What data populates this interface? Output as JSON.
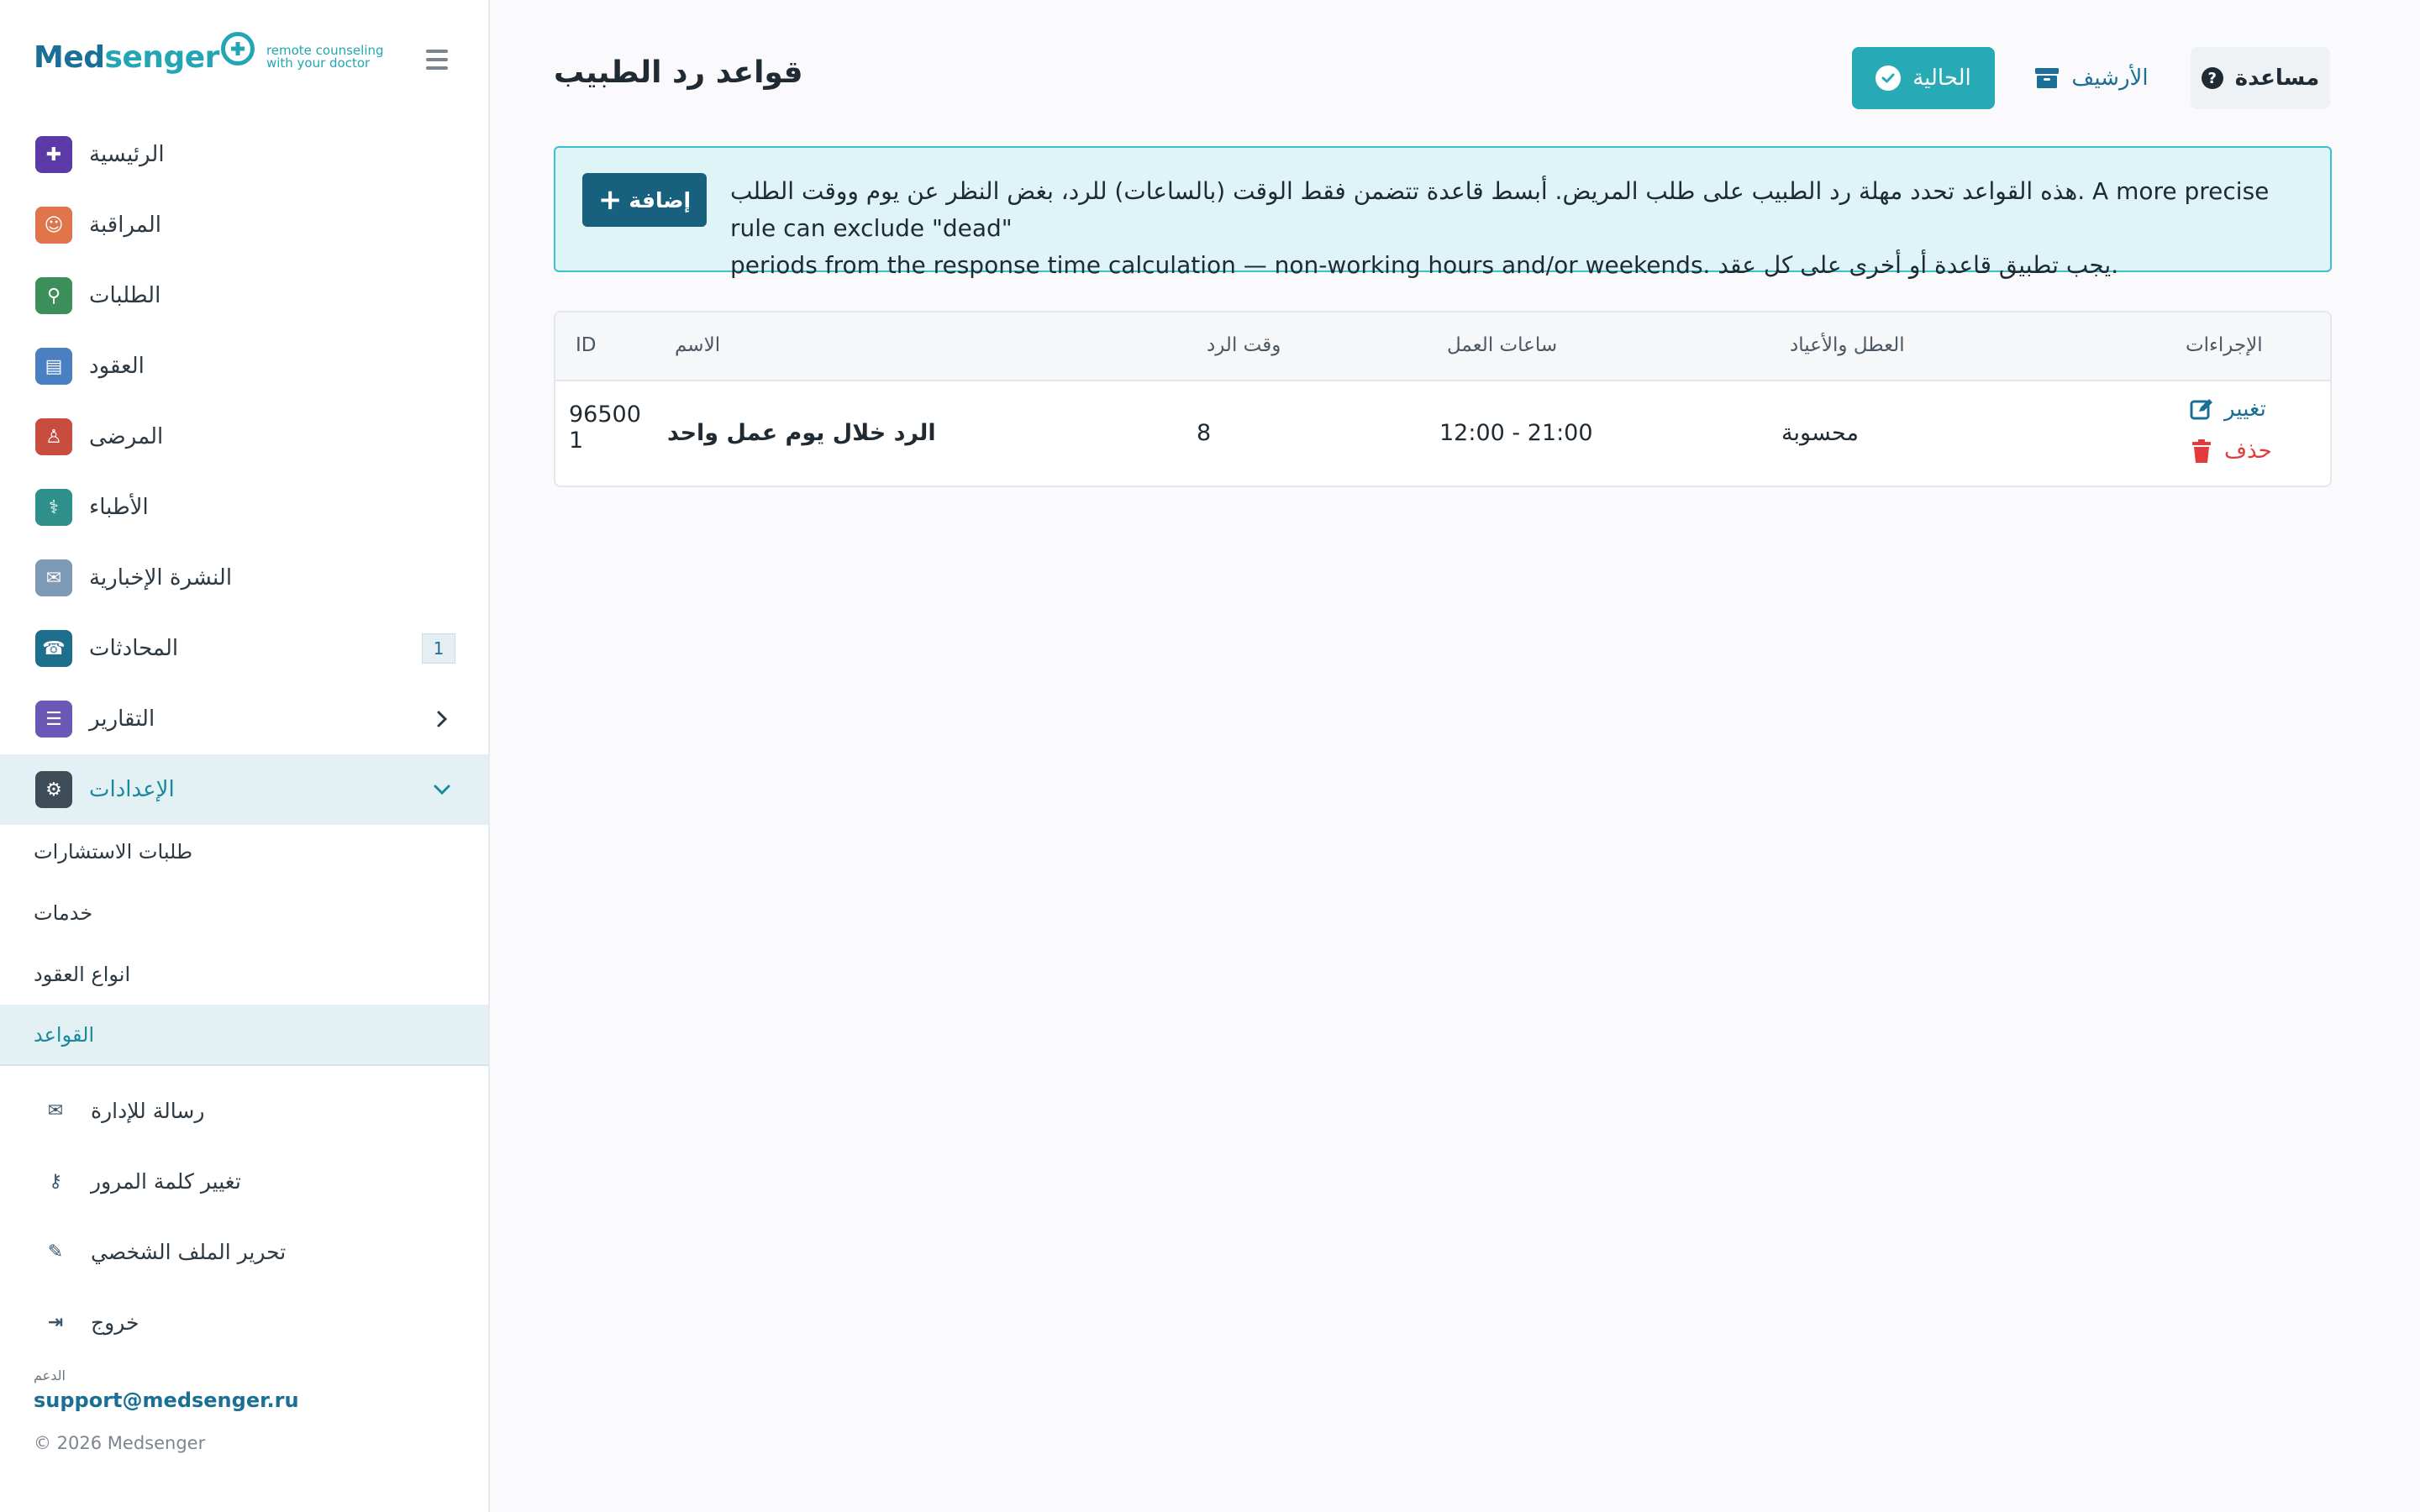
{
  "brand": {
    "name_a": "Med",
    "name_b": "senger",
    "tagline_1": "remote counseling",
    "tagline_2": "with your doctor"
  },
  "sidebar": {
    "items": [
      {
        "label": "الرئيسية",
        "icon": "hospital-icon",
        "color": "#5b3aa8"
      },
      {
        "label": "المراقبة",
        "icon": "doctor-icon",
        "color": "#e0744a"
      },
      {
        "label": "الطلبات",
        "icon": "user-search-icon",
        "color": "#3c8f5a"
      },
      {
        "label": "العقود",
        "icon": "contract-icon",
        "color": "#4a7fc1"
      },
      {
        "label": "المرضى",
        "icon": "patient-icon",
        "color": "#c94d3f"
      },
      {
        "label": "الأطباء",
        "icon": "physician-icon",
        "color": "#2f8f8a"
      },
      {
        "label": "النشرة الإخبارية",
        "icon": "mail-send-icon",
        "color": "#7e9bb5"
      },
      {
        "label": "المحادثات",
        "icon": "phone-icon",
        "color": "#1e6f8c",
        "badge": "1"
      },
      {
        "label": "التقارير",
        "icon": "report-icon",
        "color": "#6b57b6"
      },
      {
        "label": "الإعدادات",
        "icon": "gear-icon",
        "color": "#3e4c57"
      }
    ],
    "sub_items": [
      "طلبات الاستشارات",
      "خدمات",
      "انواع العقود",
      "القواعد"
    ],
    "bottom_items": [
      {
        "label": "رسالة للإدارة",
        "icon": "envelope-icon"
      },
      {
        "label": "تغيير كلمة المرور",
        "icon": "key-icon"
      },
      {
        "label": "تحرير الملف الشخصي",
        "icon": "user-edit-icon"
      },
      {
        "label": "خروج",
        "icon": "door-exit-icon"
      }
    ],
    "support_label": "الدعم",
    "support_email": "support@medsenger.ru",
    "copyright": "© 2026 Medsenger"
  },
  "header": {
    "title": "قواعد رد الطبيب",
    "btn_current": "الحالية",
    "btn_archive": "الأرشيف",
    "btn_help": "مساعدة"
  },
  "info": {
    "add_label": "إضافة",
    "line_1": "هذه القواعد تحدد مهلة رد الطبيب على طلب المريض. أبسط قاعدة تتضمن فقط الوقت (بالساعات) للرد، بغض النظر عن يوم ووقت الطلب. A more precise rule can exclude \"dead\"",
    "line_2": "periods from the response time calculation — non-working hours and/or weekends. يجب تطبيق قاعدة أو أخرى على كل عقد."
  },
  "table": {
    "headers": {
      "id": "ID",
      "name": "الاسم",
      "response": "وقت الرد",
      "hours": "ساعات العمل",
      "holidays": "العطل والأعياد",
      "actions": "الإجراءات"
    },
    "rows": [
      {
        "id_1": "96500",
        "id_2": "1",
        "name": "الرد خلال يوم عمل واحد",
        "response": "8",
        "hours": "12:00 - 21:00",
        "holidays": "محسوبة",
        "edit": "تغيير",
        "delete": "حذف"
      }
    ]
  },
  "colors": {
    "accent": "#27aab5",
    "primary": "#17607e",
    "danger": "#e23b3b"
  }
}
